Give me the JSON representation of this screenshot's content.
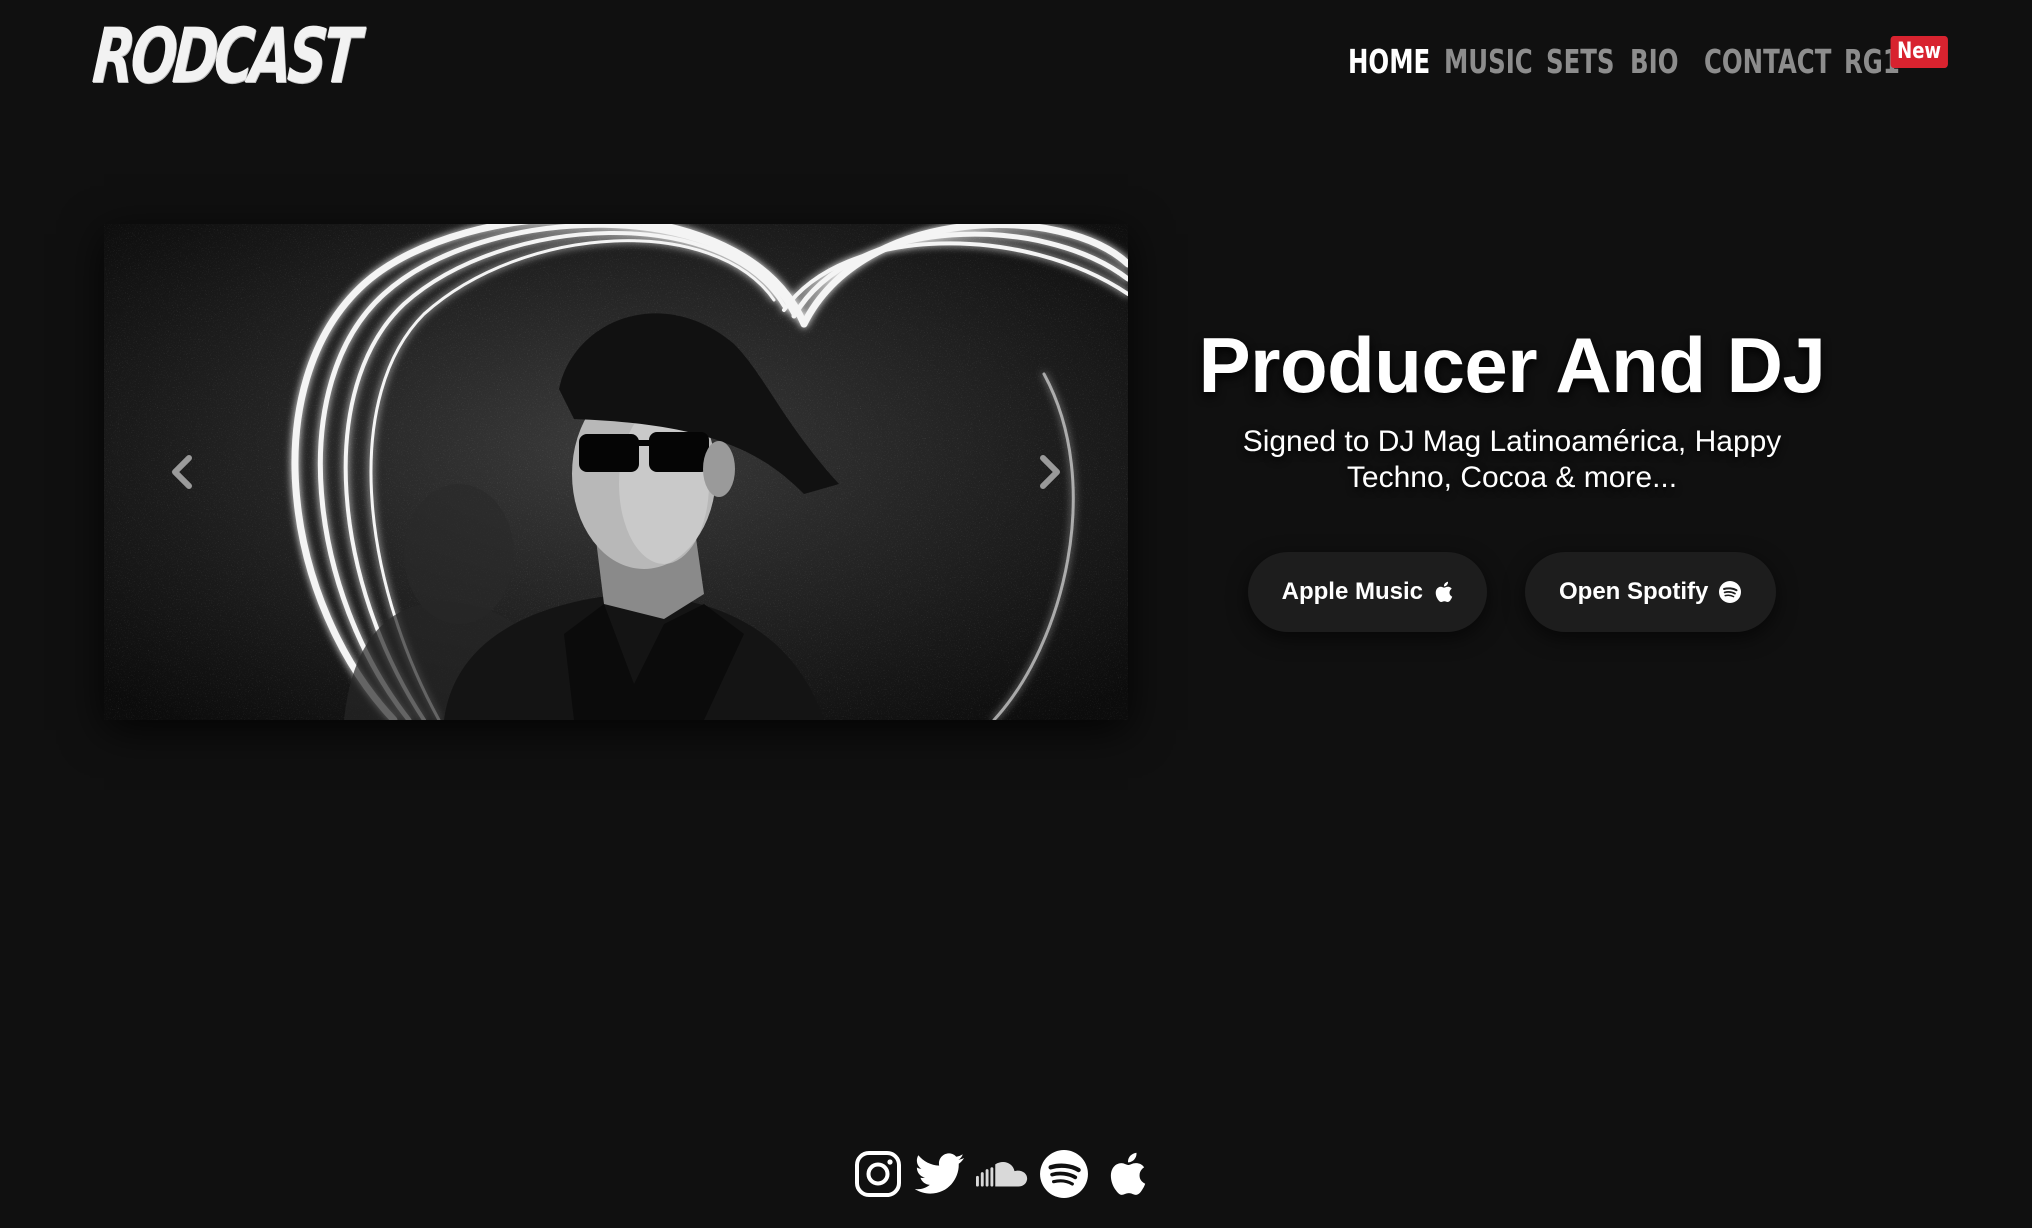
{
  "header": {
    "logo_text": "RODCAST",
    "nav": [
      {
        "label": "HOME",
        "active": true
      },
      {
        "label": "MUSIC",
        "active": false
      },
      {
        "label": "SETS",
        "active": false
      },
      {
        "label": "BIO",
        "active": false
      },
      {
        "label": "CONTACT",
        "active": false
      },
      {
        "label": "RG1",
        "active": false
      }
    ],
    "new_badge": "New"
  },
  "carousel": {
    "prev_icon": "chevron-left-icon",
    "next_icon": "chevron-right-icon"
  },
  "hero": {
    "title": "Producer And DJ",
    "subtitle": "Signed to DJ Mag Latinoamérica, Happy Techno, Cocoa & more...",
    "buttons": [
      {
        "label": "Apple Music",
        "icon": "apple-icon"
      },
      {
        "label": "Open Spotify",
        "icon": "spotify-icon"
      }
    ]
  },
  "social": [
    "instagram-icon",
    "twitter-icon",
    "soundcloud-icon",
    "spotify-icon",
    "apple-icon"
  ],
  "colors": {
    "background": "#101010",
    "nav_inactive": "#8d8d8d",
    "badge": "#d8232f",
    "button_bg": "#1d1d1d"
  }
}
